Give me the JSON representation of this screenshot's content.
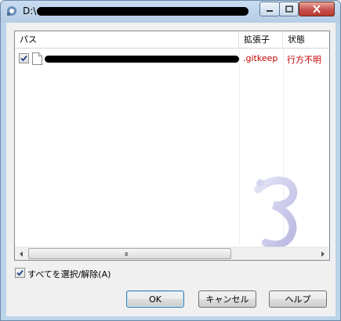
{
  "window": {
    "title": "D:\\",
    "title_redacted": true
  },
  "list": {
    "columns": [
      "パス",
      "拡張子",
      "状態"
    ],
    "rows": [
      {
        "checked": true,
        "path_redacted": true,
        "extension": ".gitkeep",
        "status": "行方不明"
      }
    ]
  },
  "scrollbar": {
    "grip": "III"
  },
  "select_all": {
    "label": "すべてを選択/解除(A)",
    "checked": true
  },
  "buttons": {
    "ok": "OK",
    "cancel": "キャンセル",
    "help": "ヘルプ"
  },
  "icons": {
    "app": "repo-browser-icon",
    "file": "file-icon",
    "watermark": "tortoise-watermark-icon",
    "check": "checkmark-icon"
  },
  "colors": {
    "missing_text": "#c00000",
    "window_frame": "#bcd4ea"
  }
}
